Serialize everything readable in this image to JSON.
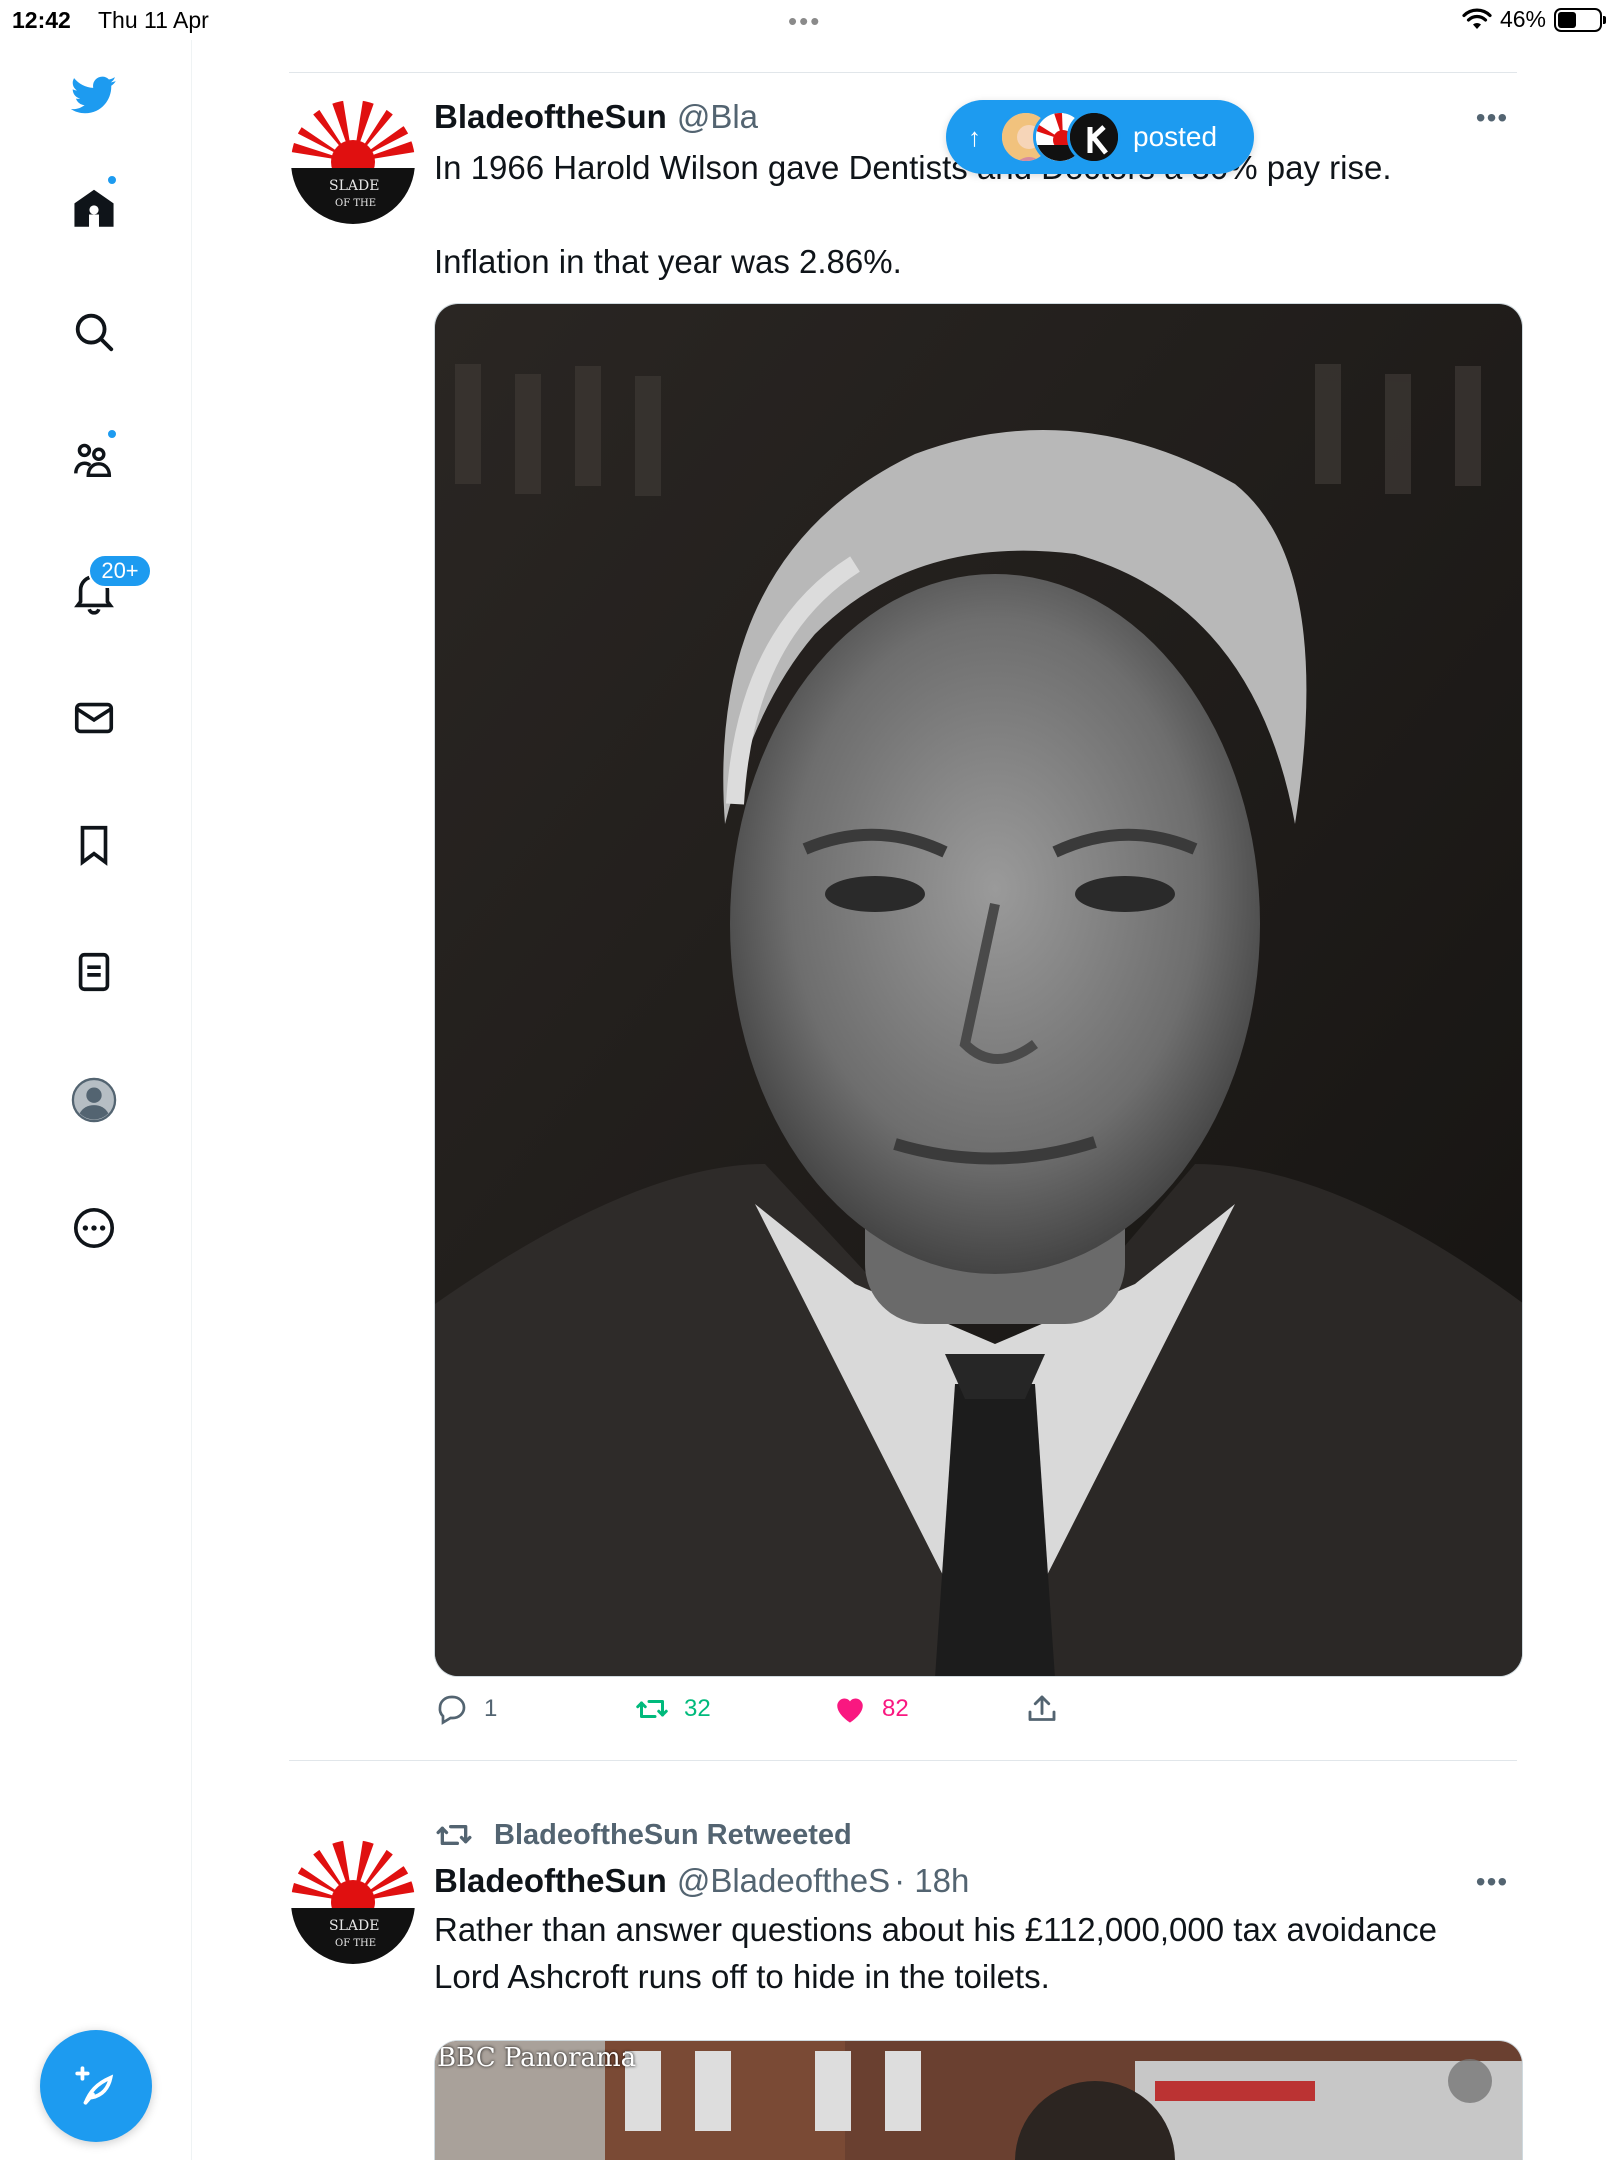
{
  "status_bar": {
    "time": "12:42",
    "date": "Thu 11 Apr",
    "battery": "46%"
  },
  "sidebar": {
    "items": [
      {
        "name": "twitter-logo",
        "icon": "twitter-bird-icon"
      },
      {
        "name": "home",
        "icon": "home-icon",
        "has_dot": true
      },
      {
        "name": "explore",
        "icon": "search-icon"
      },
      {
        "name": "communities",
        "icon": "communities-icon",
        "has_dot": true
      },
      {
        "name": "notifications",
        "icon": "bell-icon",
        "badge": "20+"
      },
      {
        "name": "messages",
        "icon": "mail-icon"
      },
      {
        "name": "bookmarks",
        "icon": "bookmark-icon"
      },
      {
        "name": "lists",
        "icon": "list-icon"
      },
      {
        "name": "profile",
        "icon": "avatar-icon"
      },
      {
        "name": "more",
        "icon": "more-circle-icon"
      }
    ],
    "compose_icon": "compose-feather-icon"
  },
  "new_posts_pill": {
    "label": "posted",
    "arrow": "↑"
  },
  "tweets": [
    {
      "name": "BladeoftheSun",
      "handle": "@Bla",
      "text": "In 1966 Harold Wilson gave Dentists and Doctors a 30% pay rise.\n\nInflation in that year was 2.86%.",
      "more": "•••",
      "actions": {
        "replies": "1",
        "retweets": "32",
        "likes": "82"
      }
    },
    {
      "retweeted_by": "BladeoftheSun Retweeted",
      "name": "BladeoftheSun",
      "handle": "@BladeoftheS",
      "time": "· 18h",
      "text": "Rather than answer questions about his £112,000,000 tax avoidance\nLord Ashcroft runs off to hide in the toilets.",
      "more": "•••",
      "video_label": "BBC Panorama"
    }
  ],
  "avatar_text": [
    "SLADE",
    "OF THE"
  ],
  "colors": {
    "accent": "#1d9bf0",
    "retweet": "#00ba7c",
    "like": "#f91880",
    "secondary": "#536471"
  }
}
